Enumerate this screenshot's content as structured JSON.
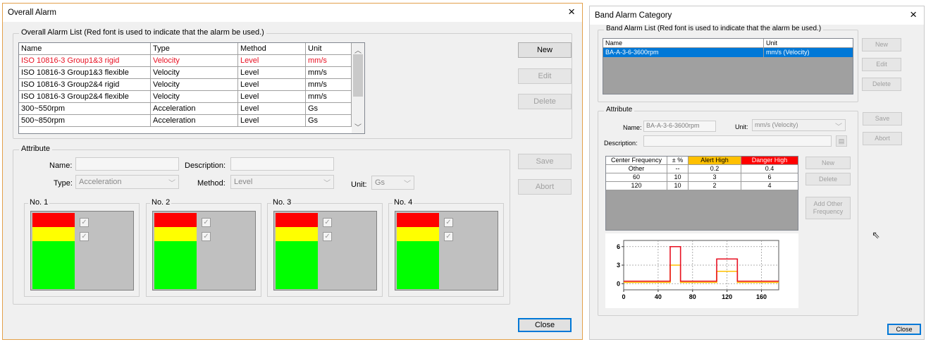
{
  "overall": {
    "title": "Overall Alarm",
    "close_icon": "×",
    "list_group_label": "Overall Alarm List (Red font is used to indicate that the alarm be used.)",
    "columns": [
      "Name",
      "Type",
      "Method",
      "Unit"
    ],
    "rows": [
      {
        "name": "ISO 10816-3 Group1&3 rigid",
        "type": "Velocity",
        "method": "Level",
        "unit": "mm/s",
        "used": true
      },
      {
        "name": "ISO 10816-3 Group1&3 flexible",
        "type": "Velocity",
        "method": "Level",
        "unit": "mm/s",
        "used": false
      },
      {
        "name": "ISO 10816-3 Group2&4 rigid",
        "type": "Velocity",
        "method": "Level",
        "unit": "mm/s",
        "used": false
      },
      {
        "name": "ISO 10816-3 Group2&4 flexible",
        "type": "Velocity",
        "method": "Level",
        "unit": "mm/s",
        "used": false
      },
      {
        "name": "300~550rpm",
        "type": "Acceleration",
        "method": "Level",
        "unit": "Gs",
        "used": false
      },
      {
        "name": "500~850rpm",
        "type": "Acceleration",
        "method": "Level",
        "unit": "Gs",
        "used": false
      }
    ],
    "buttons": {
      "new": "New",
      "edit": "Edit",
      "delete": "Delete",
      "save": "Save",
      "abort": "Abort",
      "close": "Close"
    },
    "attribute": {
      "group_label": "Attribute",
      "name_label": "Name:",
      "name_value": "",
      "description_label": "Description:",
      "description_value": "",
      "type_label": "Type:",
      "type_value": "Acceleration",
      "method_label": "Method:",
      "method_value": "Level",
      "unit_label": "Unit:",
      "unit_value": "Gs"
    },
    "levels": [
      "No. 1",
      "No. 2",
      "No. 3",
      "No. 4"
    ],
    "check_glyph": "✓",
    "colors": {
      "danger": "#ff0000",
      "alert": "#ffff00",
      "normal": "#00ff00",
      "used_text": "#e81123"
    }
  },
  "band": {
    "title": "Band Alarm Category",
    "close_icon": "×",
    "list_group_label": "Band Alarm List (Red font is used to indicate that the alarm be used.)",
    "columns": [
      "Name",
      "Unit"
    ],
    "rows": [
      {
        "name": "BA-A-3-6-3600rpm",
        "unit": "mm/s  (Velocity)",
        "selected": true
      }
    ],
    "buttons": {
      "new": "New",
      "edit": "Edit",
      "delete": "Delete",
      "save": "Save",
      "abort": "Abort",
      "freq_new": "New",
      "freq_delete": "Delete",
      "add_other": "Add Other Frequency",
      "close": "Close"
    },
    "attribute": {
      "group_label": "Attribute",
      "name_label": "Name:",
      "name_value": "BA-A-3-6-3600rpm",
      "unit_label": "Unit:",
      "unit_value": "mm/s  (Velocity)",
      "description_label": "Description:",
      "description_value": ""
    },
    "freq_table": {
      "headers": [
        "Center Frequency",
        "± %",
        "Alert High",
        "Danger High"
      ],
      "rows": [
        [
          "Other",
          "--",
          "0.2",
          "0.4"
        ],
        [
          "60",
          "10",
          "3",
          "6"
        ],
        [
          "120",
          "10",
          "2",
          "4"
        ]
      ]
    },
    "chart_data": {
      "type": "line",
      "x_ticks": [
        0,
        40,
        80,
        120,
        160
      ],
      "y_ticks": [
        0,
        3,
        6
      ],
      "xlim": [
        0,
        180
      ],
      "ylim": [
        -1,
        7
      ],
      "grid": true,
      "series": [
        {
          "color": "#ffc000",
          "x": [
            0,
            54,
            54,
            66,
            66,
            108,
            108,
            132,
            132,
            180
          ],
          "y": [
            0.2,
            0.2,
            3,
            3,
            0.2,
            0.2,
            2,
            2,
            0.2,
            0.2
          ]
        },
        {
          "color": "#e81123",
          "x": [
            0,
            54,
            54,
            66,
            66,
            108,
            108,
            132,
            132,
            180
          ],
          "y": [
            0.4,
            0.4,
            6,
            6,
            0.4,
            0.4,
            4,
            4,
            0.4,
            0.4
          ]
        }
      ]
    }
  }
}
